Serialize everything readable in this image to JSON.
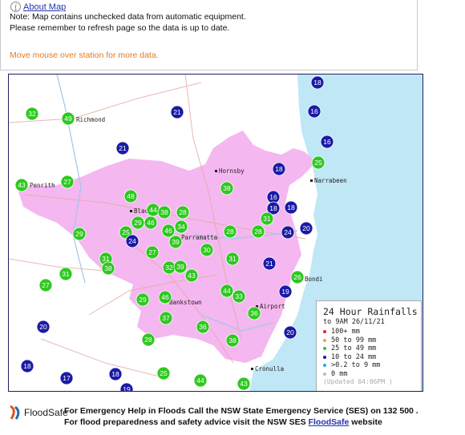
{
  "about_link": "About Map",
  "notes": [
    "Note: Map contains unchecked data from automatic equipment.",
    "Please remember to refresh page so the data is up to date."
  ],
  "hover_hint": "Move mouse over station for more data.",
  "place_labels": [
    {
      "id": "richmond",
      "text": "Richmond"
    },
    {
      "id": "penrith",
      "text": "Penrith"
    },
    {
      "id": "hornsby",
      "text": "Hornsby"
    },
    {
      "id": "narrabeen",
      "text": "Narrabeen"
    },
    {
      "id": "blacktown",
      "text": "Blacktown"
    },
    {
      "id": "parramatta",
      "text": "Parramatta"
    },
    {
      "id": "bondi",
      "text": "Bondi"
    },
    {
      "id": "bankstown",
      "text": "Bankstown"
    },
    {
      "id": "airport",
      "text": "Airport"
    },
    {
      "id": "cronulla",
      "text": "Cronulla"
    }
  ],
  "stations": [
    {
      "value": "18",
      "color": "#1a1aa6"
    },
    {
      "value": "32",
      "color": "#2ec820"
    },
    {
      "value": "49",
      "color": "#2ec820"
    },
    {
      "value": "21",
      "color": "#1a1aa6"
    },
    {
      "value": "16",
      "color": "#1a1aa6"
    },
    {
      "value": "21",
      "color": "#1a1aa6"
    },
    {
      "value": "16",
      "color": "#1a1aa6"
    },
    {
      "value": "25",
      "color": "#2ec820"
    },
    {
      "value": "18",
      "color": "#1a1aa6"
    },
    {
      "value": "43",
      "color": "#2ec820"
    },
    {
      "value": "27",
      "color": "#2ec820"
    },
    {
      "value": "38",
      "color": "#2ec820"
    },
    {
      "value": "16",
      "color": "#1a1aa6"
    },
    {
      "value": "18",
      "color": "#1a1aa6"
    },
    {
      "value": "18",
      "color": "#1a1aa6"
    },
    {
      "value": "48",
      "color": "#2ec820"
    },
    {
      "value": "44",
      "color": "#2ec820"
    },
    {
      "value": "38",
      "color": "#2ec820"
    },
    {
      "value": "28",
      "color": "#2ec820"
    },
    {
      "value": "29",
      "color": "#2ec820"
    },
    {
      "value": "46",
      "color": "#2ec820"
    },
    {
      "value": "34",
      "color": "#2ec820"
    },
    {
      "value": "31",
      "color": "#2ec820"
    },
    {
      "value": "29",
      "color": "#2ec820"
    },
    {
      "value": "25",
      "color": "#2ec820"
    },
    {
      "value": "46",
      "color": "#2ec820"
    },
    {
      "value": "28",
      "color": "#2ec820"
    },
    {
      "value": "28",
      "color": "#2ec820"
    },
    {
      "value": "24",
      "color": "#1a1aa6"
    },
    {
      "value": "20",
      "color": "#1a1aa6"
    },
    {
      "value": "24",
      "color": "#1a1aa6"
    },
    {
      "value": "39",
      "color": "#2ec820"
    },
    {
      "value": "27",
      "color": "#2ec820"
    },
    {
      "value": "30",
      "color": "#2ec820"
    },
    {
      "value": "31",
      "color": "#2ec820"
    },
    {
      "value": "31",
      "color": "#2ec820"
    },
    {
      "value": "38",
      "color": "#2ec820"
    },
    {
      "value": "32",
      "color": "#2ec820"
    },
    {
      "value": "39",
      "color": "#2ec820"
    },
    {
      "value": "21",
      "color": "#1a1aa6"
    },
    {
      "value": "31",
      "color": "#2ec820"
    },
    {
      "value": "43",
      "color": "#2ec820"
    },
    {
      "value": "26",
      "color": "#2ec820"
    },
    {
      "value": "27",
      "color": "#2ec820"
    },
    {
      "value": "44",
      "color": "#2ec820"
    },
    {
      "value": "19",
      "color": "#1a1aa6"
    },
    {
      "value": "33",
      "color": "#2ec820"
    },
    {
      "value": "29",
      "color": "#2ec820"
    },
    {
      "value": "46",
      "color": "#2ec820"
    },
    {
      "value": "36",
      "color": "#2ec820"
    },
    {
      "value": "20",
      "color": "#1a1aa6"
    },
    {
      "value": "37",
      "color": "#2ec820"
    },
    {
      "value": "36",
      "color": "#2ec820"
    },
    {
      "value": "20",
      "color": "#1a1aa6"
    },
    {
      "value": "28",
      "color": "#2ec820"
    },
    {
      "value": "38",
      "color": "#2ec820"
    },
    {
      "value": "18",
      "color": "#1a1aa6"
    },
    {
      "value": "17",
      "color": "#1a1aa6"
    },
    {
      "value": "18",
      "color": "#1a1aa6"
    },
    {
      "value": "25",
      "color": "#2ec820"
    },
    {
      "value": "44",
      "color": "#2ec820"
    },
    {
      "value": "43",
      "color": "#2ec820"
    },
    {
      "value": "19",
      "color": "#1a1aa6"
    }
  ],
  "legend": {
    "title": "24 Hour Rainfalls",
    "subtitle": "to 9AM 26/11/21",
    "items": [
      {
        "label": "100+ mm",
        "color": "#e8202a"
      },
      {
        "label": "50 to 99 mm",
        "color": "#f2a81e"
      },
      {
        "label": "25 to 49 mm",
        "color": "#2ec820"
      },
      {
        "label": "10 to 24 mm",
        "color": "#1a1aa6"
      },
      {
        "label": ">0.2 to 9 mm",
        "color": "#22aaee"
      },
      {
        "label": "0 mm",
        "color": "#bbbbbb"
      }
    ],
    "updated": "(Updated 04:06PM  )"
  },
  "footer": {
    "logo_text": "FloodSafe",
    "line1": "For Emergency Help in Floods Call the NSW State Emergency Service (SES) on 132 500 .",
    "line2_pre": "For flood preparedness and safety advice visit the NSW SES ",
    "line2_link": "FloodSafe",
    "line2_post": " website"
  },
  "colors": {
    "ocean": "#bfe7f6",
    "urban": "#f4b7f0",
    "station_green": "#2ec820",
    "station_blue": "#1a1aa6",
    "link": "#2233aa",
    "hint": "#e27a1e"
  }
}
